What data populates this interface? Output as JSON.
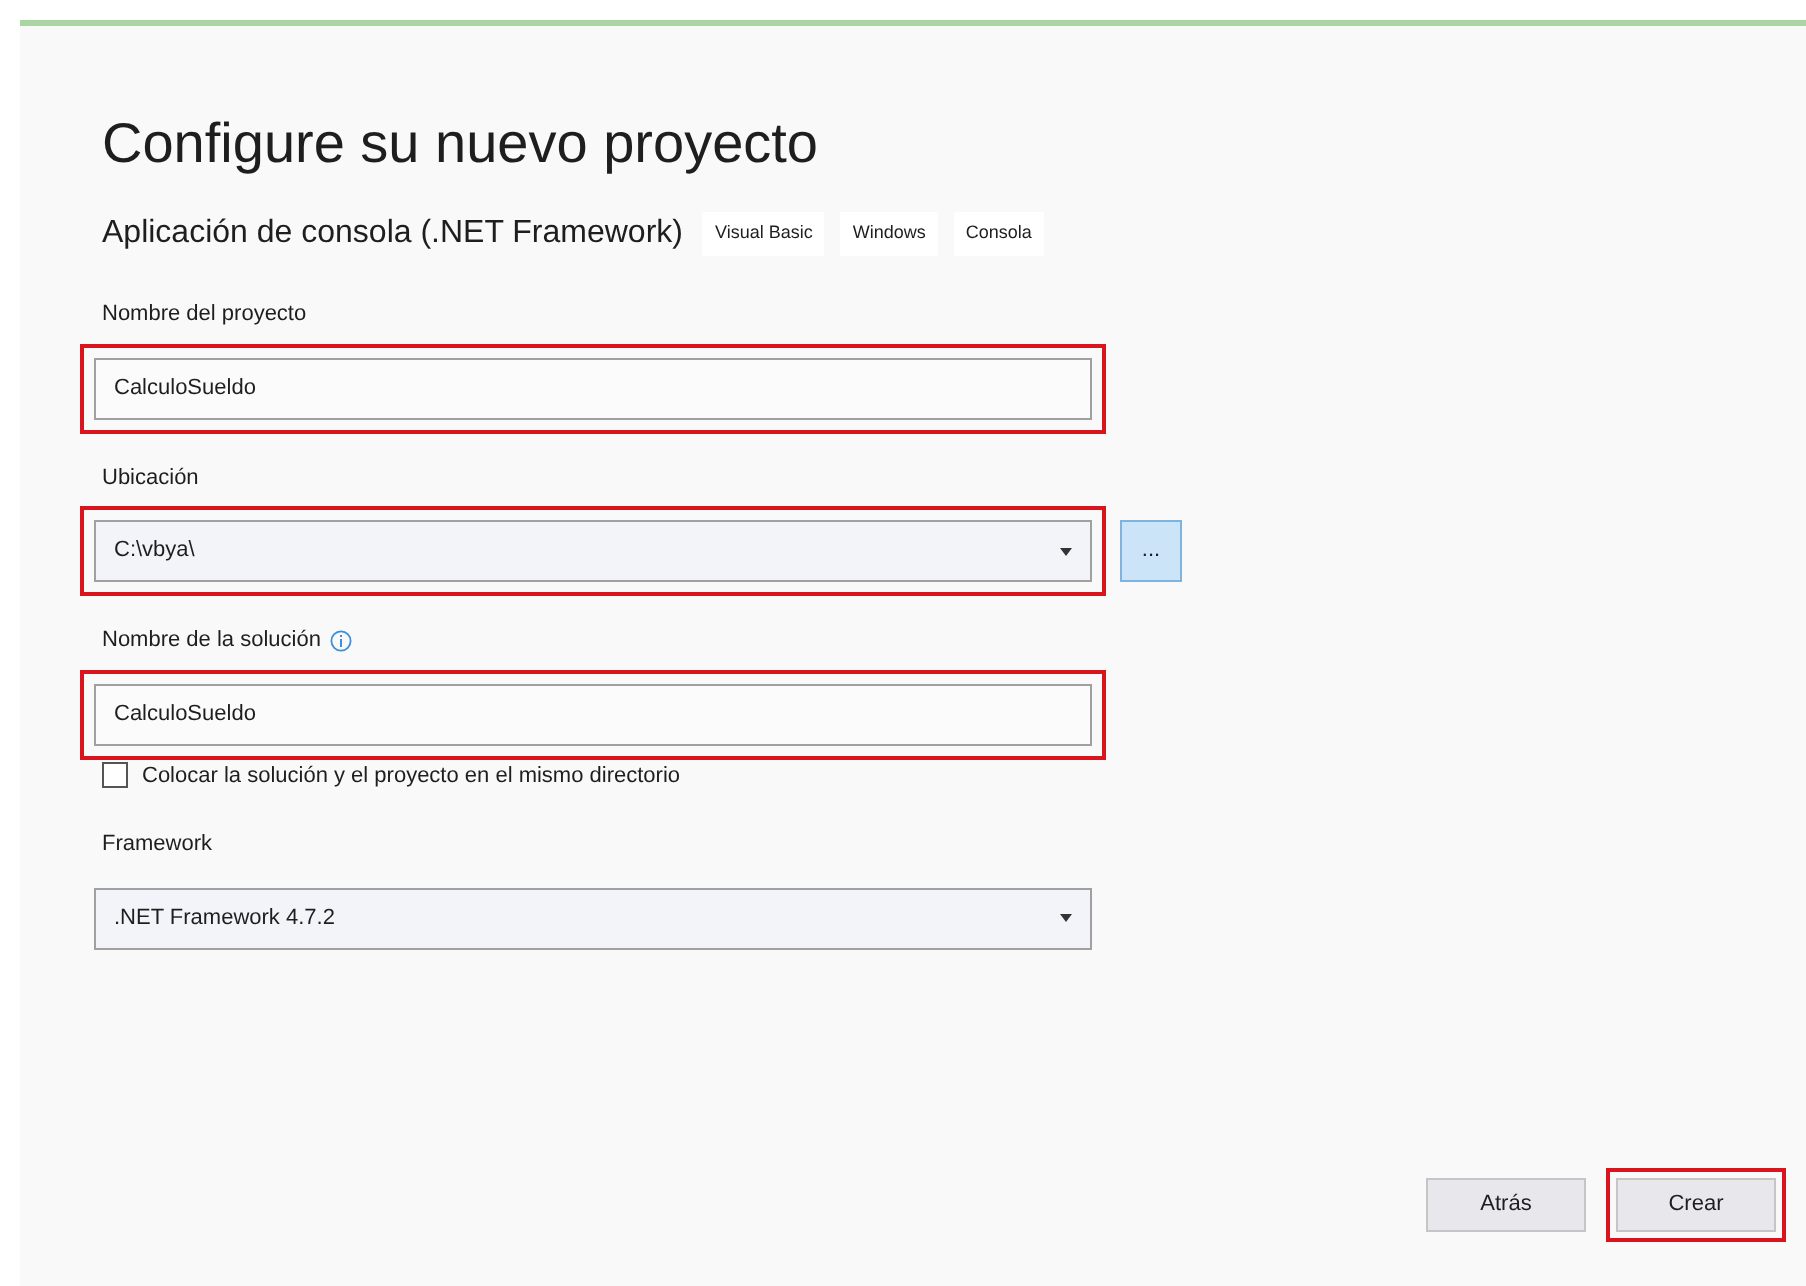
{
  "title": "Configure su nuevo proyecto",
  "template": {
    "name": "Aplicación de consola (.NET Framework)",
    "tags": [
      "Visual Basic",
      "Windows",
      "Consola"
    ]
  },
  "fields": [
    {
      "kind": "text",
      "label": "Nombre del proyecto",
      "value": "CalculoSueldo",
      "highlighted": true,
      "info": false
    },
    {
      "kind": "combo",
      "label": "Ubicación",
      "value": "C:\\vbya\\",
      "highlighted": true,
      "info": false,
      "browse": "..."
    },
    {
      "kind": "text",
      "label": "Nombre de la solución",
      "value": "CalculoSueldo",
      "highlighted": true,
      "info": true
    },
    {
      "kind": "checkbox",
      "label": "Colocar la solución y el proyecto en el mismo directorio",
      "checked": false
    },
    {
      "kind": "combo",
      "label": "Framework",
      "value": ".NET Framework 4.7.2",
      "highlighted": false,
      "info": false
    }
  ],
  "buttons": [
    {
      "label": "Atrás",
      "highlighted": false
    },
    {
      "label": "Crear",
      "highlighted": true
    }
  ]
}
